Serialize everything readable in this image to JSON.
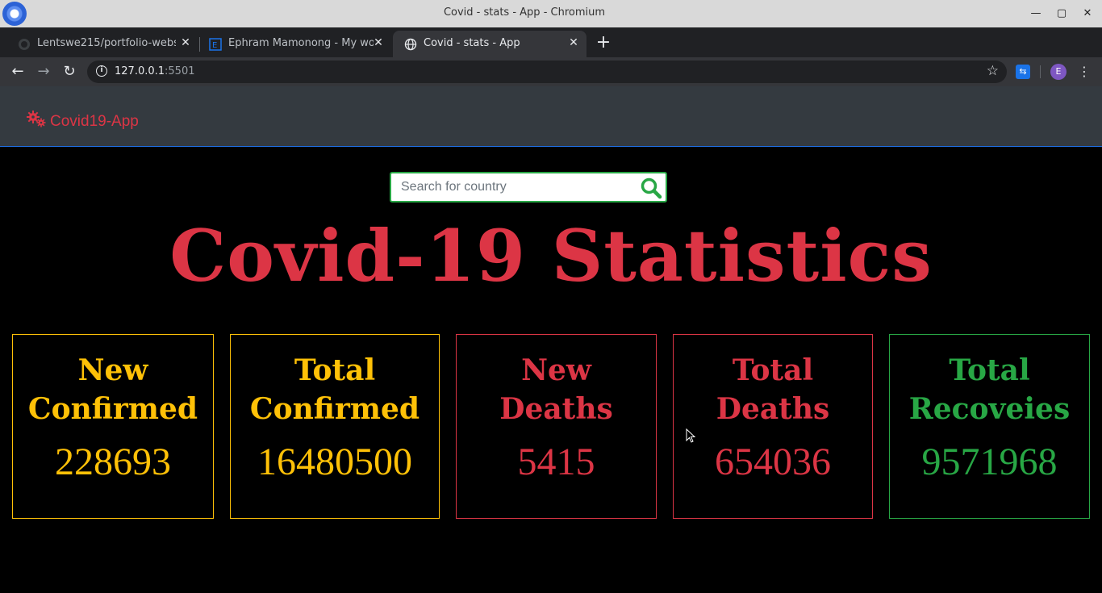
{
  "window": {
    "title": "Covid - stats - App - Chromium"
  },
  "tabs": [
    {
      "label": "Lentswe215/portfolio-websit",
      "active": false
    },
    {
      "label": "Ephram Mamonong - My work",
      "active": false
    },
    {
      "label": "Covid - stats - App",
      "active": true
    }
  ],
  "toolbar": {
    "url_host": "127.0.0.1",
    "url_port": ":5501",
    "profile_initial": "E"
  },
  "navbar": {
    "brand": "Covid19-App"
  },
  "search": {
    "placeholder": "Search for country",
    "value": ""
  },
  "headline": "Covid-19 Statistics",
  "stats": [
    {
      "line1": "New",
      "line2": "Confirmed",
      "value": "228693",
      "color": "#ffc107"
    },
    {
      "line1": "Total",
      "line2": "Confirmed",
      "value": "16480500",
      "color": "#ffc107"
    },
    {
      "line1": "New",
      "line2": "Deaths",
      "value": "5415",
      "color": "#dc3545"
    },
    {
      "line1": "Total",
      "line2": "Deaths",
      "value": "654036",
      "color": "#dc3545"
    },
    {
      "line1": "Total",
      "line2": "Recoveies",
      "value": "9571968",
      "color": "#28a745"
    }
  ],
  "colors": {
    "accent": "#dc3545",
    "navbar_bg": "#343a40",
    "success": "#28a745",
    "warning": "#ffc107"
  }
}
